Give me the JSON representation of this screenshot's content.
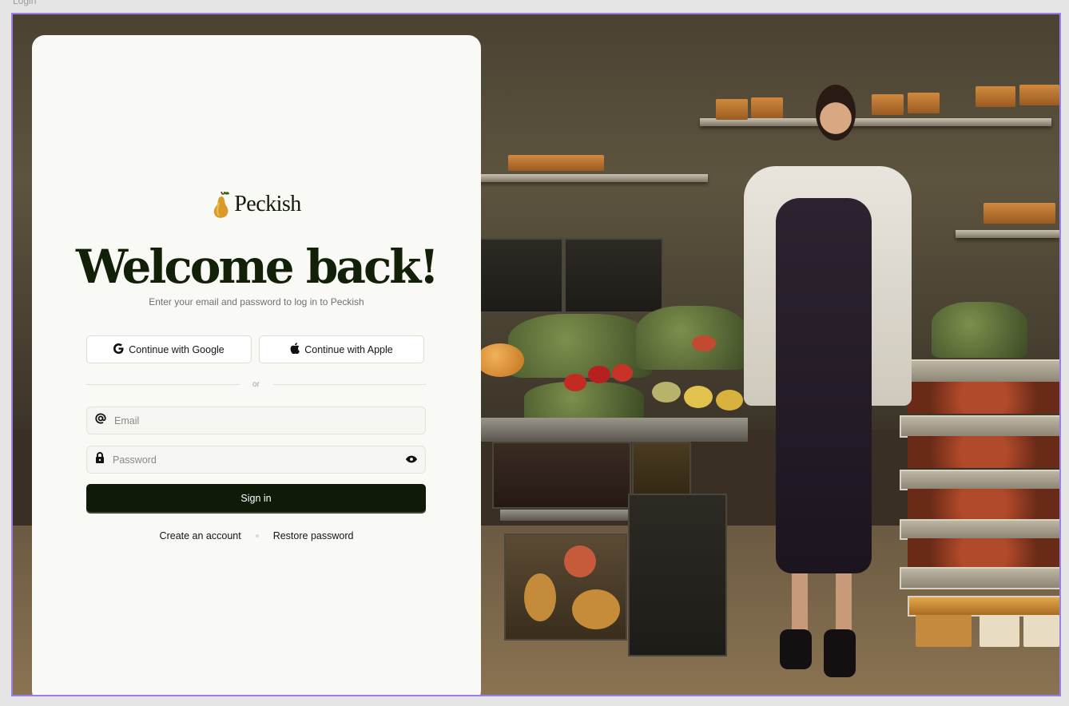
{
  "frame_label": "Login",
  "brand": {
    "name": "Peckish",
    "logo_icon": "pear-icon"
  },
  "heading": "Welcome back!",
  "subtitle": "Enter your email and password to log in to Peckish",
  "oauth": {
    "google_label": "Continue with Google",
    "apple_label": "Continue with Apple"
  },
  "divider_text": "or",
  "email": {
    "placeholder": "Email",
    "value": ""
  },
  "password": {
    "placeholder": "Password",
    "value": ""
  },
  "signin_label": "Sign in",
  "links": {
    "create_account": "Create an account",
    "restore_password": "Restore password"
  },
  "colors": {
    "primary": "#0f1a08",
    "card_bg": "#f9f9f5",
    "frame_border": "#9b7fe6"
  }
}
